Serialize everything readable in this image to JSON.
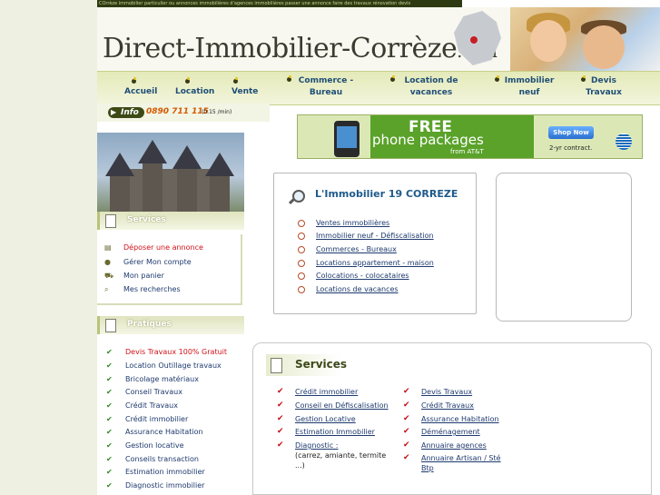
{
  "ticker": "COrrèze immobilier particulier ou annonces immobilières d'agences immobilières passer une annonce faire des travaux rénovation devis",
  "header": {
    "title_main": "Direct-Immobilier-Corrèze",
    "title_suffix": ".com"
  },
  "nav": [
    {
      "label": "Accueil"
    },
    {
      "label": "Location"
    },
    {
      "label": "Vente"
    },
    {
      "label": "Commerce - Bureau"
    },
    {
      "label": "Location de vacances"
    },
    {
      "label": "Immobilier neuf"
    },
    {
      "label": "Devis Travaux"
    }
  ],
  "info": {
    "badge": "Info",
    "phone": "0890 711 115",
    "price": "(0.15 /min)"
  },
  "ad": {
    "headline": "FREE",
    "sub": "phone packages",
    "from": "from AT&T",
    "cta": "Shop Now",
    "contract": "2-yr contract."
  },
  "sidebar": {
    "services_head": "Services",
    "services": [
      {
        "label": "Déposer une annonce",
        "icon": "list-icon",
        "red": true
      },
      {
        "label": "Gérer Mon compte",
        "icon": "user-icon",
        "red": false
      },
      {
        "label": "Mon panier",
        "icon": "cart-icon",
        "red": false
      },
      {
        "label": "Mes recherches",
        "icon": "search-icon",
        "red": false
      }
    ],
    "pratiques_head": "Pratiques",
    "pratiques": [
      {
        "label": "Devis Travaux 100% Gratuit",
        "red": true
      },
      {
        "label": "Location Outillage travaux",
        "red": false
      },
      {
        "label": "Bricolage matériaux",
        "red": false
      },
      {
        "label": "Conseil Travaux",
        "red": false
      },
      {
        "label": "Crédit Travaux",
        "red": false
      },
      {
        "label": "Crédit immobilier",
        "red": false
      },
      {
        "label": "Assurance Habitation",
        "red": false
      },
      {
        "label": "Gestion locative",
        "red": false
      },
      {
        "label": "Conseils transaction",
        "red": false
      },
      {
        "label": "Estimation immobilier",
        "red": false
      },
      {
        "label": "Diagnostic immobilier",
        "red": false
      }
    ]
  },
  "immo": {
    "title": "L'Immobilier 19 CORREZE",
    "links": [
      "Ventes immobilières",
      "Immobilier neuf - Défiscalisation",
      "Commerces - Bureaux",
      "Locations appartement - maison",
      "Colocations - colocataires",
      "Locations de vacances"
    ]
  },
  "services": {
    "title": "Services",
    "col1": [
      "Crédit immobilier",
      "Conseil en Défiscalisation",
      "Gestion Locative",
      "Estimation Immobilier",
      "Diagnostic :"
    ],
    "col1_note_1": "(carrez, amiante, termite",
    "col1_note_2": "...)",
    "col2": [
      "Devis Travaux",
      "Crédit Travaux",
      "Assurance Habitation",
      "Déménagement",
      "Annuaire agences",
      "Annuaire Artisan / Sté"
    ],
    "col2_note": "Btp"
  }
}
